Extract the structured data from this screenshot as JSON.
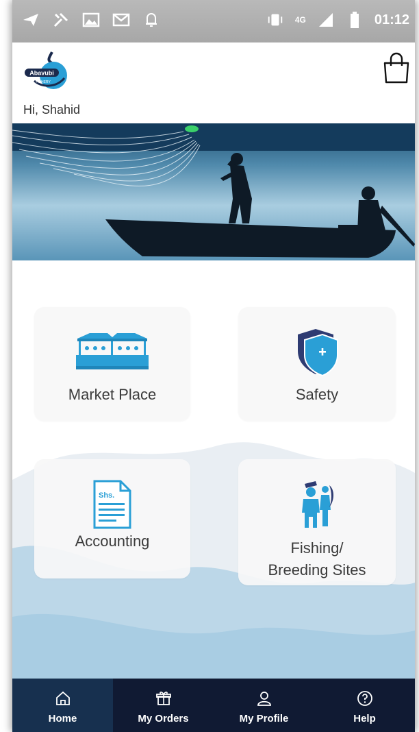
{
  "statusbar": {
    "time": "01:12",
    "network": "4G",
    "icons": [
      "send-icon",
      "tools-icon",
      "gallery-icon",
      "mail-icon",
      "bell-icon",
      "vibrate-icon",
      "signal-icon",
      "battery-icon"
    ]
  },
  "header": {
    "logo_text": "Abavubi",
    "logo_subtext": "FISHERY",
    "cart_icon": "shopping-bag-icon"
  },
  "greeting": "Hi, Shahid",
  "cards": [
    {
      "label": "Market Place",
      "icon": "market-stall-icon"
    },
    {
      "label": "Safety",
      "icon": "shield-plus-icon"
    },
    {
      "label": "Accounting",
      "icon": "document-shs-icon",
      "icon_text": "Shs."
    },
    {
      "label_line1": "Fishing/",
      "label_line2": "Breeding Sites",
      "icon": "fishermen-icon"
    }
  ],
  "bottomnav": {
    "items": [
      {
        "label": "Home",
        "icon": "home-icon",
        "active": true
      },
      {
        "label": "My Orders",
        "icon": "orders-box-icon",
        "active": false
      },
      {
        "label": "My Profile",
        "icon": "profile-icon",
        "active": false
      },
      {
        "label": "Help",
        "icon": "help-icon",
        "active": false
      }
    ]
  },
  "colors": {
    "accent": "#2a9fd6",
    "nav_bg": "#101a33",
    "nav_active": "#17304f",
    "shield_dark": "#2e3b72"
  }
}
